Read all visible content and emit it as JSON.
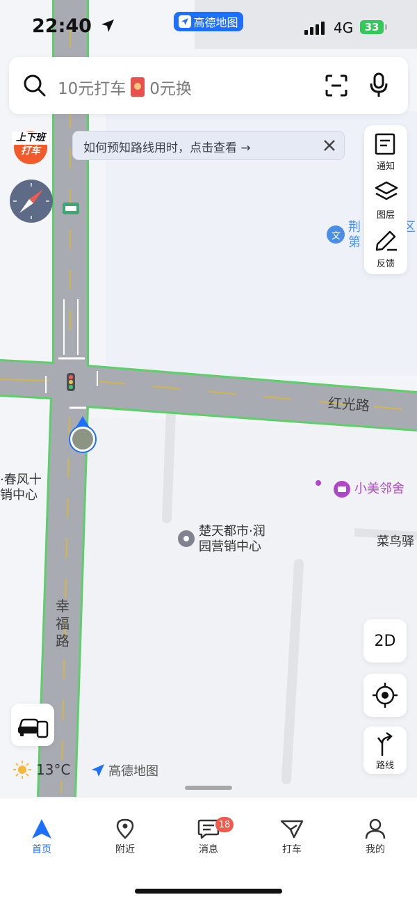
{
  "status_bar": {
    "time": "22:40",
    "app_name": "高德地图",
    "network": "4G",
    "battery": "33"
  },
  "search": {
    "placeholder_left": "10元打车",
    "placeholder_right": "0元换"
  },
  "commute_badge": {
    "line1": "上下班",
    "line2": "打车"
  },
  "tip": {
    "text": "如何预知路线用时，点击查看 →"
  },
  "tools": {
    "notify": "通知",
    "layers": "图层",
    "feedback": "反馈"
  },
  "map_controls": {
    "mode_2d": "2D",
    "route": "路线"
  },
  "map_labels": {
    "road_hongguang": "红光路",
    "road_xingfu": [
      "幸",
      "福",
      "路"
    ],
    "poi_chutian_1": "楚天都市·润",
    "poi_chutian_2": "园营销中心",
    "poi_chunfeng_1": "·春风十",
    "poi_chunfeng_2": "销中心",
    "poi_xiaomei": "小美邻舍",
    "poi_cainiao": "菜鸟驿",
    "poi_jing_1": "荆",
    "poi_jing_2": "第",
    "poi_jing_3": "区"
  },
  "weather": {
    "temp": "13°C",
    "logo_text": "高德地图"
  },
  "tabs": [
    {
      "label": "首页",
      "active": true
    },
    {
      "label": "附近"
    },
    {
      "label": "消息",
      "badge": "18"
    },
    {
      "label": "打车"
    },
    {
      "label": "我的"
    }
  ],
  "colors": {
    "accent": "#1d6fff",
    "route_green": "#5ccf6a",
    "road_gray": "#a9abb3",
    "badge_red": "#f05a4f",
    "poi_purple": "#b047c9"
  }
}
